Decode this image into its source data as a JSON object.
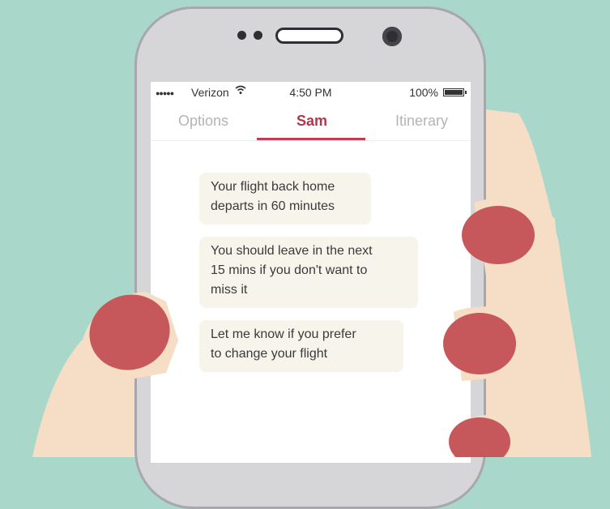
{
  "status_bar": {
    "signal": "●●●●●",
    "carrier": "Verizon",
    "wifi_icon": "wifi-icon",
    "time": "4:50 PM",
    "battery": "100%"
  },
  "tabs": [
    {
      "label": "Options",
      "active": false
    },
    {
      "label": "Sam",
      "active": true
    },
    {
      "label": "Itinerary",
      "active": false
    }
  ],
  "messages": [
    {
      "lines": [
        "Your flight back home",
        "departs in 60 minutes"
      ]
    },
    {
      "lines": [
        "You should leave in the next",
        "15 mins if you don't want to",
        "miss it"
      ]
    },
    {
      "lines": [
        "Let me know if you prefer",
        "to change your flight"
      ]
    }
  ],
  "colors": {
    "background": "#a9d8cb",
    "accent": "#c53a52",
    "bubble": "#f7f4ec",
    "skin": "#f6ddc5",
    "nail": "#c6575a"
  }
}
